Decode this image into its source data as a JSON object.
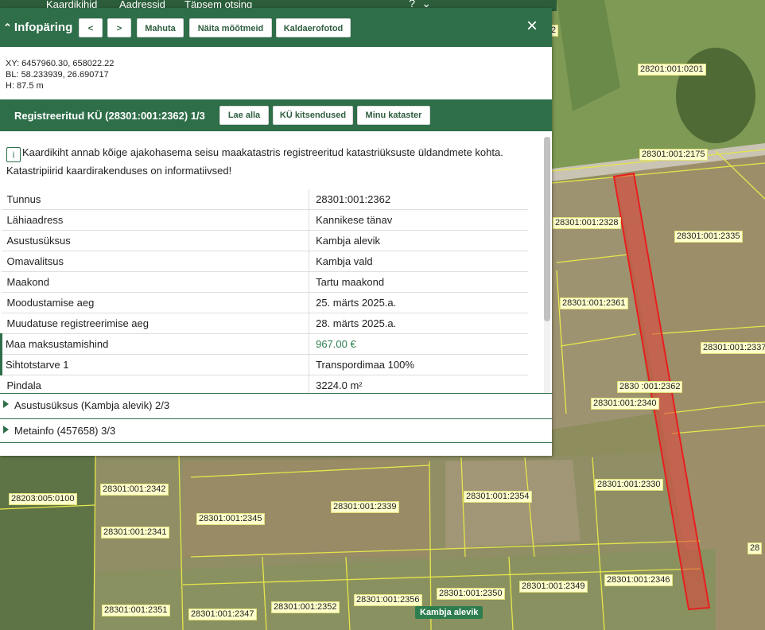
{
  "topbar": {
    "items": [
      "Kaardikihid",
      "Aadressid",
      "Täpsem otsing"
    ],
    "help_icon": "?",
    "collapse_icon": "double-chevron-down"
  },
  "panel": {
    "title": "Infopäring",
    "buttons": {
      "prev": "<",
      "next": ">",
      "fit": "Mahuta",
      "measure": "Näita mõõtmeid",
      "oblique": "Kaldaerofotod"
    },
    "close_icon": "×",
    "coords": {
      "xy": "XY: 6457960.30, 658022.22",
      "bl": "BL: 58.233939, 26.690717",
      "h": "H: 87.5 m"
    },
    "registry": {
      "title": "Registreeritud KÜ (28301:001:2362) 1/3",
      "buttons": {
        "download": "Lae alla",
        "restrictions": "KÜ kitsendused",
        "my_cadastre": "Minu kataster"
      },
      "info_text": "Kaardikiht annab kõige ajakohasema seisu maakatastris registreeritud katastriüksuste üldandmete kohta. Katastripiirid kaardirakenduses on informatiivsed!",
      "rows": [
        {
          "label": "Tunnus",
          "value": "28301:001:2362"
        },
        {
          "label": "Lähiaadress",
          "value": "Kannikese tänav"
        },
        {
          "label": "Asustusüksus",
          "value": "Kambja alevik"
        },
        {
          "label": "Omavalitsus",
          "value": "Kambja vald"
        },
        {
          "label": "Maakond",
          "value": "Tartu maakond"
        },
        {
          "label": "Moodustamise aeg",
          "value": "25. märts 2025.a."
        },
        {
          "label": "Muudatuse registreerimise aeg",
          "value": "28. märts 2025.a."
        },
        {
          "label": "Maa maksustamishind",
          "value": "967.00 €"
        },
        {
          "label": "Sihtotstarve 1",
          "value": "Transpordimaa 100%"
        },
        {
          "label": "Pindala",
          "value": "3224.0 m²"
        }
      ]
    },
    "sections": [
      {
        "label": "Asustusüksus (Kambja alevik) 2/3"
      },
      {
        "label": "Metainfo (457658) 3/3"
      }
    ]
  },
  "map": {
    "parcel_labels": [
      "2",
      "28201:001:0201",
      "28301:001:2175",
      "28301:001:2328",
      "28301:001:2335",
      "28301:001:2361",
      "28301:001:2337",
      "2830 :001:2362",
      "28301:001:2340",
      "28301:001:2342",
      "28203:005:0100",
      "28301:001:2339",
      "28301:001:2354",
      "28301:001:2330",
      "28301:001:2345",
      "28301:001:2341",
      "28301:001:2351",
      "28301:001:2347",
      "28301:001:2352",
      "28301:001:2356",
      "28301:001:2350",
      "28301:001:2349",
      "28301:001:2346",
      "28"
    ],
    "place_label": "Kambja alevik",
    "colors": {
      "accent": "#2e6e49",
      "parcel_highlight": "#e0423a",
      "boundary": "#e6e64a"
    }
  }
}
